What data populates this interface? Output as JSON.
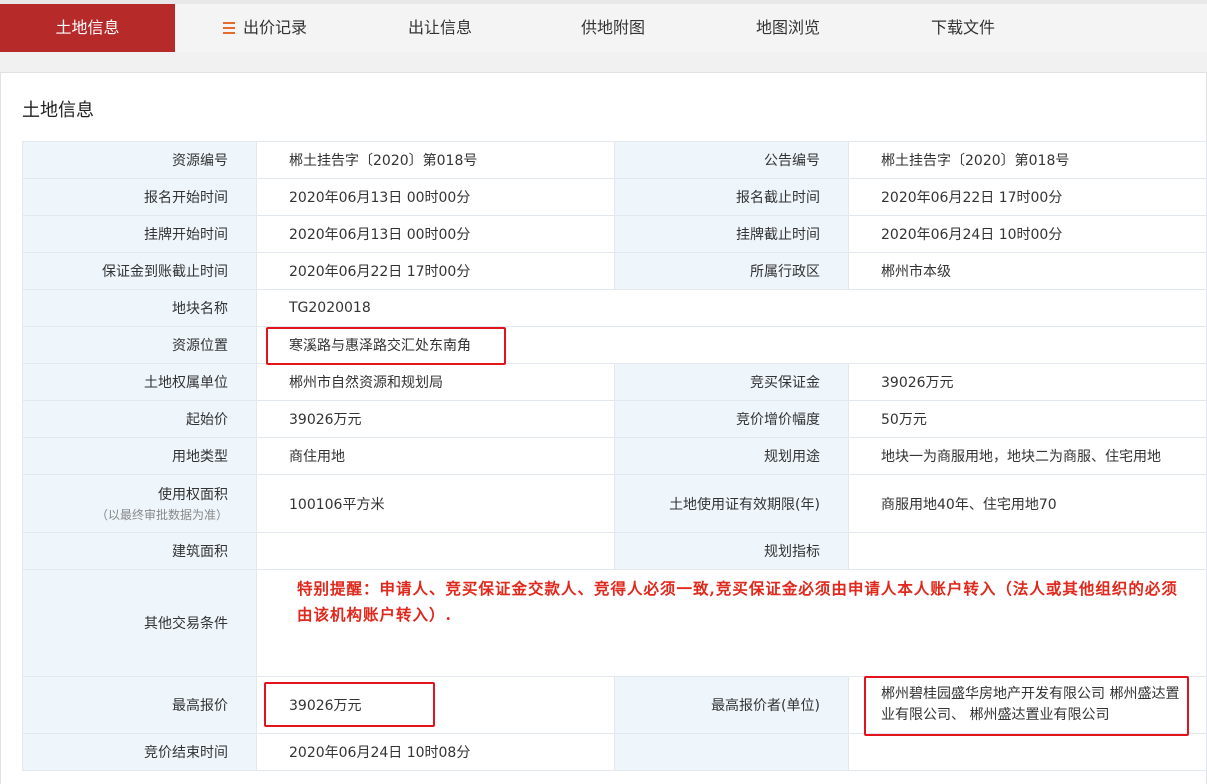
{
  "tabs": [
    {
      "label": "土地信息"
    },
    {
      "label": "出价记录"
    },
    {
      "label": "出让信息"
    },
    {
      "label": "供地附图"
    },
    {
      "label": "地图浏览"
    },
    {
      "label": "下载文件"
    }
  ],
  "section_title": "土地信息",
  "rows": {
    "r1": {
      "l1": "资源编号",
      "v1": "郴土挂告字〔2020〕第018号",
      "l2": "公告编号",
      "v2": "郴土挂告字〔2020〕第018号"
    },
    "r2": {
      "l1": "报名开始时间",
      "v1": "2020年06月13日 00时00分",
      "l2": "报名截止时间",
      "v2": "2020年06月22日 17时00分"
    },
    "r3": {
      "l1": "挂牌开始时间",
      "v1": "2020年06月13日 00时00分",
      "l2": "挂牌截止时间",
      "v2": "2020年06月24日 10时00分"
    },
    "r4": {
      "l1": "保证金到账截止时间",
      "v1": "2020年06月22日 17时00分",
      "l2": "所属行政区",
      "v2": "郴州市本级"
    },
    "r5": {
      "l1": "地块名称",
      "v1": "TG2020018"
    },
    "r6": {
      "l1": "资源位置",
      "v1": "寒溪路与惠泽路交汇处东南角"
    },
    "r7": {
      "l1": "土地权属单位",
      "v1": "郴州市自然资源和规划局",
      "l2": "竞买保证金",
      "v2": "39026万元"
    },
    "r8": {
      "l1": "起始价",
      "v1": "39026万元",
      "l2": "竞价增价幅度",
      "v2": "50万元"
    },
    "r9": {
      "l1": "用地类型",
      "v1": "商住用地",
      "l2": "规划用途",
      "v2": "地块一为商服用地，地块二为商服、住宅用地"
    },
    "r10": {
      "l1": "使用权面积",
      "l1_note": "（以最终审批数据为准）",
      "v1": "100106平方米",
      "l2": "土地使用证有效期限(年)",
      "v2": "商服用地40年、住宅用地70"
    },
    "r11": {
      "l1": "建筑面积",
      "v1": "",
      "l2": "规划指标",
      "v2": ""
    },
    "r12": {
      "l1": "其他交易条件",
      "notice": "特别提醒：申请人、竞买保证金交款人、竞得人必须一致,竞买保证金必须由申请人本人账户转入（法人或其他组织的必须由该机构账户转入）."
    },
    "r13": {
      "l1": "最高报价",
      "v1": "39026万元",
      "l2": "最高报价者(单位)",
      "v2": "郴州碧桂园盛华房地产开发有限公司 郴州盛达置业有限公司、 郴州盛达置业有限公司"
    },
    "r14": {
      "l1": "竞价结束时间",
      "v1": "2020年06月24日 10时08分"
    }
  },
  "colors": {
    "active_tab": "#b72a2a",
    "label_bg": "#eef6fc",
    "notice": "#e0281c",
    "highlight": "#e3131b"
  }
}
